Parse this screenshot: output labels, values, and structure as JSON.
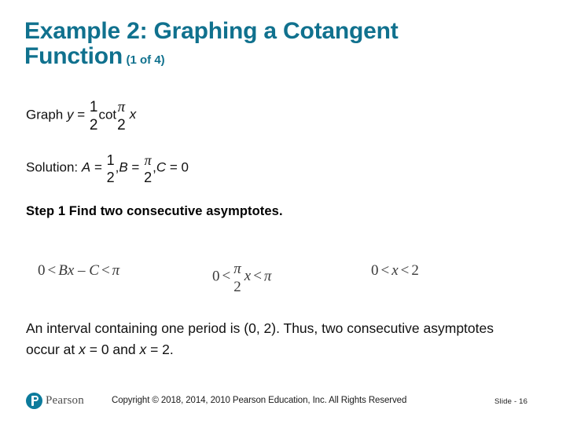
{
  "slide": {
    "title_line1": "Example 2: Graphing a Cotangent",
    "title_line2": "Function",
    "part_indicator": "(1 of 4)",
    "title_color": "#10718e"
  },
  "graph_line": {
    "lead": "Graph ",
    "var_y": "y",
    "equals": " = ",
    "coef_num": "1",
    "coef_den": "2",
    "function": "cot",
    "arg_num": "π",
    "arg_den": "2",
    "var_x": "x"
  },
  "solution_line": {
    "label": "Solution: ",
    "a_var": "A",
    "a_equals": " = ",
    "a_num": "1",
    "a_den": "2",
    "sep1": ",",
    "b_var": "B",
    "b_equals": " = ",
    "b_num": "π",
    "b_den": "2",
    "sep2": ",",
    "c_var": "C",
    "c_equals": " = ",
    "c_value": "0"
  },
  "step": {
    "text": "Step 1 Find two consecutive asymptotes."
  },
  "inequalities": [
    {
      "id": "general-form",
      "zero": "0",
      "lt1": "<",
      "mid_b": "B",
      "mid_x": "x",
      "minus": " – ",
      "mid_c": "C",
      "lt2": "<",
      "right": "π"
    },
    {
      "id": "substituted",
      "zero": "0",
      "lt1": "<",
      "num": "π",
      "den": "2",
      "var_x": "x",
      "lt2": "<",
      "right": "π"
    },
    {
      "id": "solved",
      "zero": "0",
      "lt1": "<",
      "var_x": "x",
      "lt2": "<",
      "right": "2"
    }
  ],
  "conclusion": {
    "part1": "An interval containing one period is (0, 2). Thus, two consecutive asymptotes occur at ",
    "var_x1": "x",
    "part2": " = 0 and ",
    "var_x2": "x",
    "part3": " = 2."
  },
  "footer": {
    "logo_text": "Pearson",
    "copyright": "Copyright © 2018, 2014, 2010 Pearson Education, Inc. All Rights Reserved",
    "slide_number": "Slide - 16",
    "brand_color": "#0c7b9c"
  }
}
